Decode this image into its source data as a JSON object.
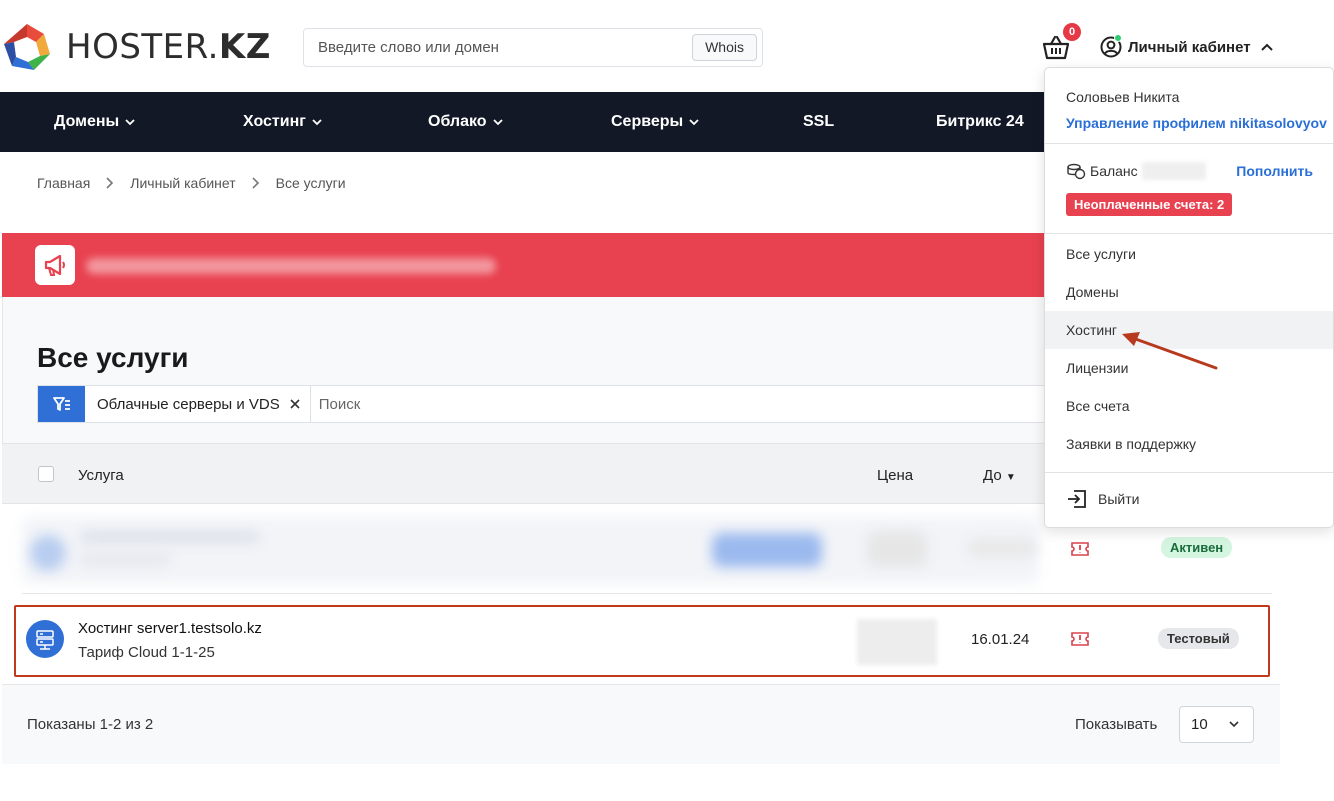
{
  "brand": {
    "name_light": "HOSTER.",
    "name_bold": "KZ"
  },
  "search": {
    "placeholder": "Введите слово или домен",
    "button": "Whois"
  },
  "cart": {
    "count": "0",
    "icon": "basket-icon"
  },
  "account": {
    "label": "Личный кабинет",
    "icon": "user-circle-icon",
    "status_color": "#2ecc71"
  },
  "nav": {
    "items": [
      {
        "label": "Домены",
        "has_menu": true
      },
      {
        "label": "Хостинг",
        "has_menu": true
      },
      {
        "label": "Облако",
        "has_menu": true
      },
      {
        "label": "Серверы",
        "has_menu": true
      },
      {
        "label": "SSL",
        "has_menu": false
      },
      {
        "label": "Битрикс 24",
        "has_menu": false
      }
    ]
  },
  "breadcrumb": [
    "Главная",
    "Личный кабинет",
    "Все услуги"
  ],
  "page": {
    "title": "Все услуги"
  },
  "filter": {
    "chip": "Облачные серверы и VDS",
    "search_placeholder": "Поиск"
  },
  "table": {
    "headers": {
      "service": "Услуга",
      "price": "Цена",
      "until": "До"
    },
    "rows": [
      {
        "status": "Активен",
        "status_color": "#d4f5e0"
      },
      {
        "name": "Хостинг server1.testsolo.kz",
        "plan": "Тариф Cloud 1-1-25",
        "until": "16.01.24",
        "status": "Тестовый",
        "status_color": "#e5e7ea"
      }
    ]
  },
  "footer": {
    "shown": "Показаны 1-2 из 2",
    "show_label": "Показывать",
    "per_page": "10"
  },
  "dropdown": {
    "user_name": "Соловьев Никита",
    "profile_link": "Управление профилем nikitasolovyov",
    "balance_label": "Баланс",
    "topup": "Пополнить",
    "unpaid": "Неоплаченные счета: 2",
    "items": [
      "Все услуги",
      "Домены",
      "Хостинг",
      "Лицензии",
      "Все счета",
      "Заявки в поддержку"
    ],
    "logout": "Выйти"
  },
  "colors": {
    "accent": "#2f6fd6",
    "nav_bg": "#121826",
    "alert": "#e8414f",
    "highlight": "#c0391b"
  }
}
